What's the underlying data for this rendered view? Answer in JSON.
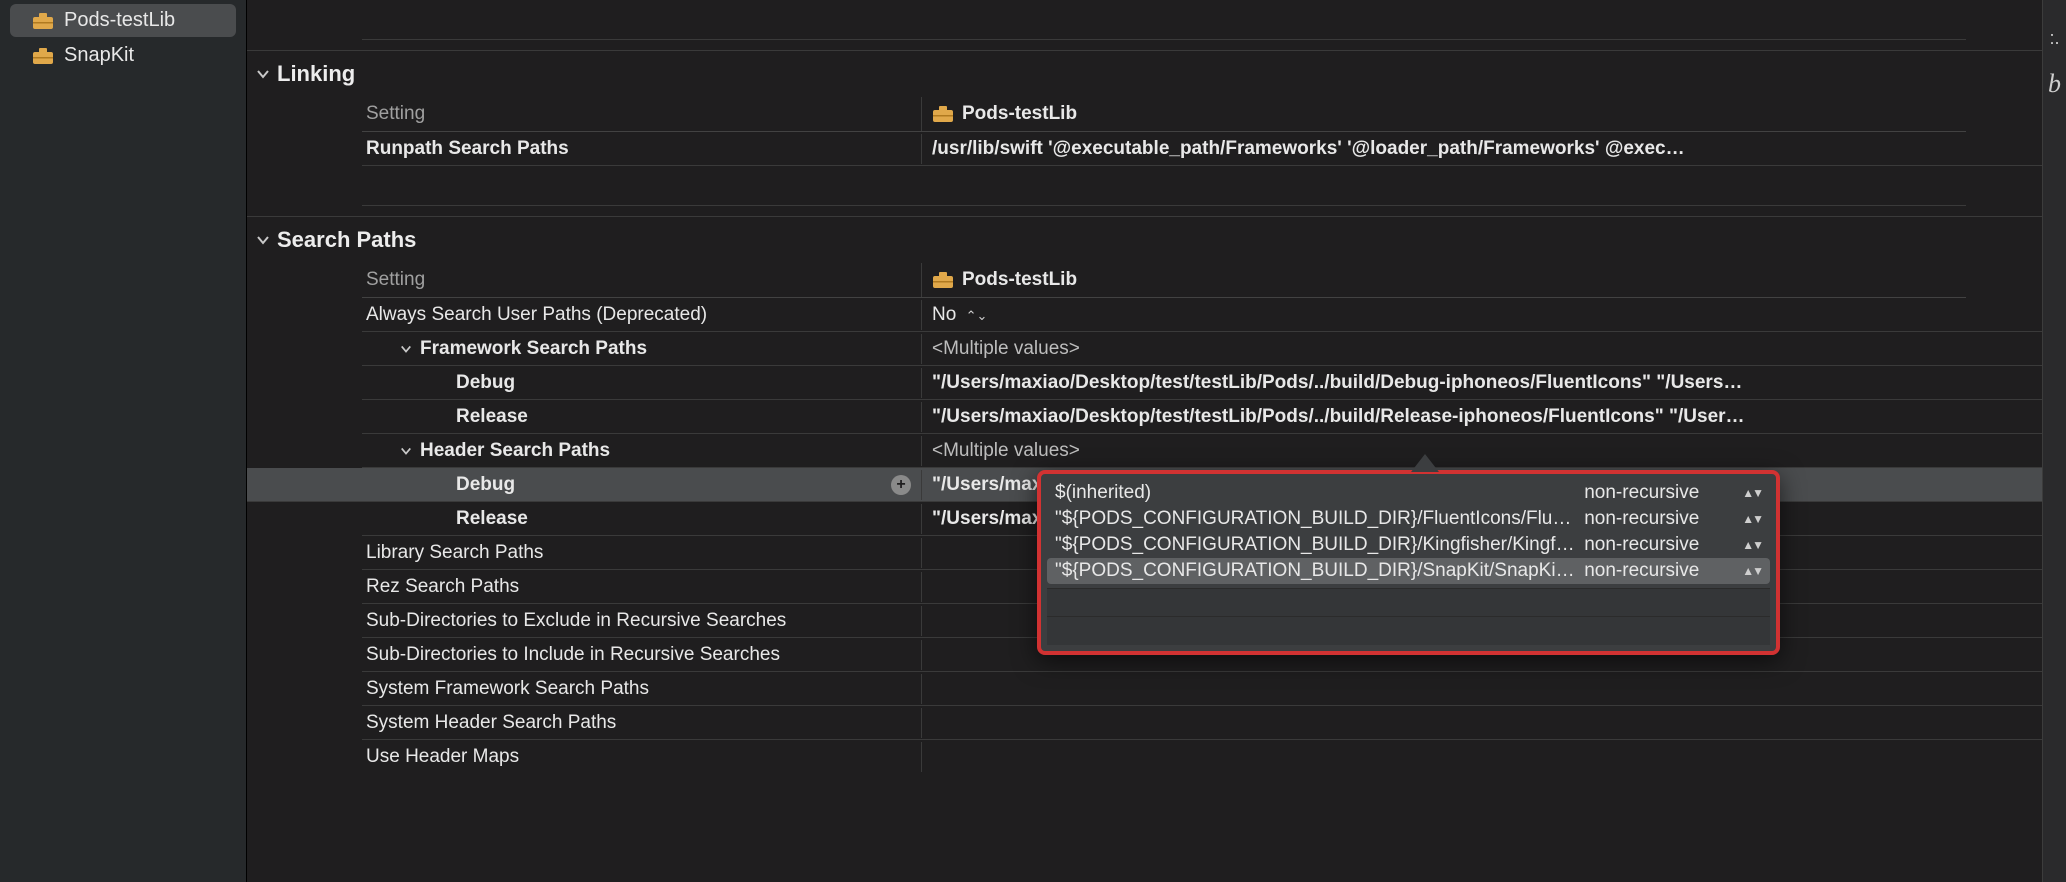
{
  "sidebar": {
    "items": [
      {
        "label": "Pods-testLib",
        "selected": true
      },
      {
        "label": "SnapKit",
        "selected": false
      }
    ]
  },
  "right_gutter": {
    "top": ":.",
    "bottom": "b"
  },
  "sections": {
    "linking": {
      "title": "Linking",
      "column_setting": "Setting",
      "column_target": "Pods-testLib",
      "rows": [
        {
          "label": "Runpath Search Paths",
          "value": "/usr/lib/swift '@executable_path/Frameworks' '@loader_path/Frameworks' @exec…"
        }
      ]
    },
    "search_paths": {
      "title": "Search Paths",
      "column_setting": "Setting",
      "column_target": "Pods-testLib",
      "always_search": {
        "label": "Always Search User Paths (Deprecated)",
        "value": "No"
      },
      "framework_search": {
        "label": "Framework Search Paths",
        "value": "<Multiple values>",
        "debug_label": "Debug",
        "debug_value": "\"/Users/maxiao/Desktop/test/testLib/Pods/../build/Debug-iphoneos/FluentIcons\" \"/Users…",
        "release_label": "Release",
        "release_value": "\"/Users/maxiao/Desktop/test/testLib/Pods/../build/Release-iphoneos/FluentIcons\" \"/User…"
      },
      "header_search": {
        "label": "Header Search Paths",
        "value": "<Multiple values>",
        "debug_label": "Debug",
        "debug_value": "\"/Users/maxiao/Desktop/test/testLib/Pods/../build/Debug-iphoneos/FluentIcons/FluentIc…",
        "release_label": "Release",
        "release_value": "\"/Users/maxiao/Desktop/test/testLib/Pods/../build/Release-iphoneos/FluentIcons/FluentI…"
      },
      "library_search": {
        "label": "Library Search Paths"
      },
      "rez_search": {
        "label": "Rez Search Paths"
      },
      "subdirs_exclude": {
        "label": "Sub-Directories to Exclude in Recursive Searches"
      },
      "subdirs_include": {
        "label": "Sub-Directories to Include in Recursive Searches"
      },
      "sys_framework": {
        "label": "System Framework Search Paths"
      },
      "sys_header": {
        "label": "System Header Search Paths"
      },
      "use_header_maps": {
        "label": "Use Header Maps"
      }
    }
  },
  "popover": {
    "rows": [
      {
        "path": "$(inherited)",
        "scope": "non-recursive"
      },
      {
        "path": "\"${PODS_CONFIGURATION_BUILD_DIR}/FluentIcons/FluentIcons.fram…",
        "scope": "non-recursive"
      },
      {
        "path": "\"${PODS_CONFIGURATION_BUILD_DIR}/Kingfisher/Kingfisher.framew…",
        "scope": "non-recursive"
      },
      {
        "path": "\"${PODS_CONFIGURATION_BUILD_DIR}/SnapKit/SnapKit.framework/H…",
        "scope": "non-recursive"
      }
    ]
  }
}
